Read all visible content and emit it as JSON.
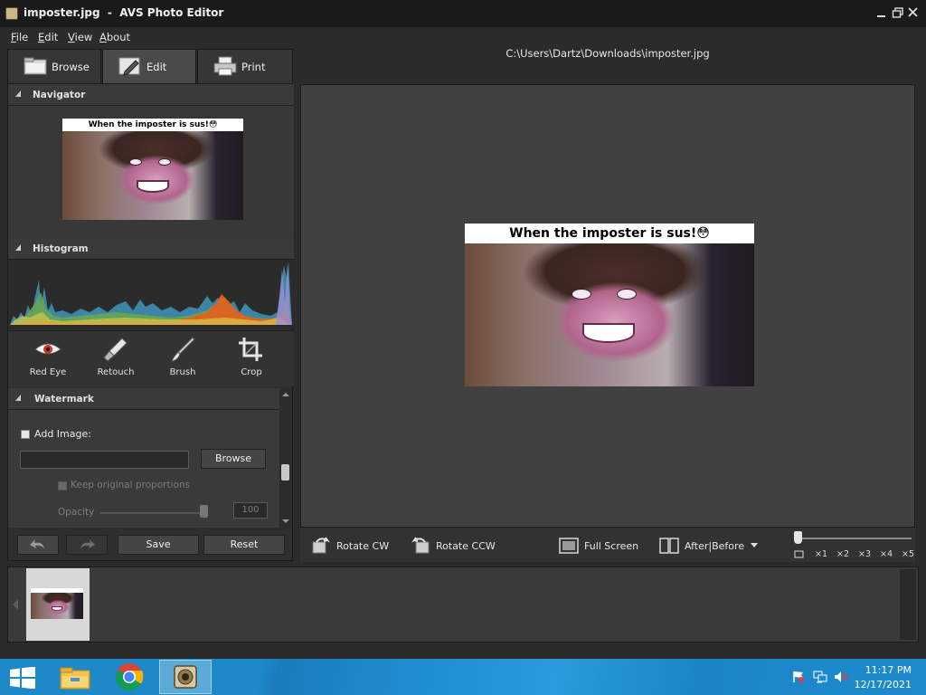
{
  "window": {
    "title": "imposter.jpg  -  AVS Photo Editor",
    "controls": [
      "minimize",
      "restore",
      "close"
    ]
  },
  "menu": [
    "File",
    "Edit",
    "View",
    "About"
  ],
  "file_path": "C:\\Users\\Dartz\\Downloads\\imposter.jpg",
  "tabs": [
    {
      "label": "Browse",
      "icon": "folder-icon",
      "active": false
    },
    {
      "label": "Edit",
      "icon": "edit-icon",
      "active": true
    },
    {
      "label": "Print",
      "icon": "printer-icon",
      "active": false
    }
  ],
  "panels": {
    "navigator": {
      "title": "Navigator"
    },
    "histogram": {
      "title": "Histogram"
    },
    "tools": [
      {
        "label": "Red Eye",
        "icon": "eye-icon"
      },
      {
        "label": "Retouch",
        "icon": "retouch-brush-icon"
      },
      {
        "label": "Brush",
        "icon": "paintbrush-icon"
      },
      {
        "label": "Crop",
        "icon": "crop-icon"
      }
    ],
    "watermark": {
      "title": "Watermark",
      "add_image_label": "Add Image:",
      "add_image_checked": false,
      "image_path_value": "",
      "browse_label": "Browse",
      "keep_proportions_label": "Keep original proportions",
      "keep_proportions_checked": false,
      "opacity_label": "Opacity",
      "opacity_value": "100"
    }
  },
  "edit_actions": {
    "save_label": "Save",
    "reset_label": "Reset"
  },
  "image": {
    "caption": "When the imposter is sus!😳"
  },
  "bottom_toolbar": {
    "rotate_cw": "Rotate CW",
    "rotate_ccw": "Rotate CCW",
    "full_screen": "Full Screen",
    "after_before": "After|Before"
  },
  "zoom": {
    "labels": [
      "×1",
      "×2",
      "×3",
      "×4",
      "×5"
    ],
    "level": 0
  },
  "taskbar": {
    "apps": [
      "windows-start",
      "file-explorer",
      "chrome",
      "avs-photo-editor"
    ],
    "time": "11:17 PM",
    "date": "12/17/2021"
  },
  "colors": {
    "window_bg": "#2b2b2b",
    "panel_header": "#3a3a3a",
    "canvas_bg": "#414141",
    "taskbar": "#1e89c9"
  }
}
